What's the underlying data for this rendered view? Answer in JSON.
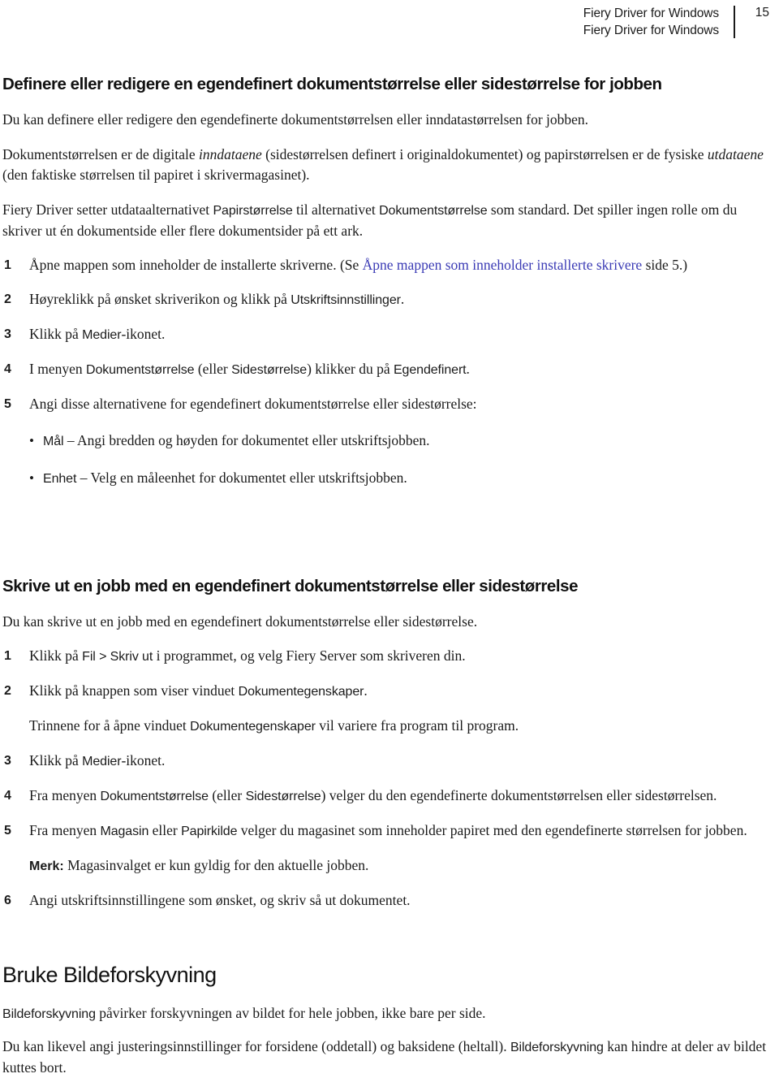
{
  "header": {
    "line1": "Fiery Driver for Windows",
    "line2": "Fiery Driver for Windows",
    "page_number": "15"
  },
  "section1": {
    "title": "Definere eller redigere en egendefinert dokumentstørrelse eller sidestørrelse for jobben",
    "intro": "Du kan definere eller redigere den egendefinerte dokumentstørrelsen eller inndatastørrelsen for jobben.",
    "para2_a": "Dokumentstørrelsen er de digitale ",
    "para2_italic1": "inndataene",
    "para2_b": " (sidestørrelsen definert i originaldokumentet) og papirstørrelsen er de fysiske ",
    "para2_italic2": "utdataene",
    "para2_c": " (den faktiske størrelsen til papiret i skrivermagasinet).",
    "para3_a": "Fiery Driver setter utdataalternativet ",
    "para3_ui1": "Papirstørrelse",
    "para3_b": " til alternativet ",
    "para3_ui2": "Dokumentstørrelse",
    "para3_c": " som standard. Det spiller ingen rolle om du skriver ut én dokumentside eller flere dokumentsider på ett ark.",
    "steps": [
      {
        "num": "1",
        "text_a": "Åpne mappen som inneholder de installerte skriverne. (Se ",
        "link": "Åpne mappen som inneholder installerte skrivere",
        "text_b": " side 5.)"
      },
      {
        "num": "2",
        "text_a": "Høyreklikk på ønsket skriverikon og klikk på ",
        "ui": "Utskriftsinnstillinger",
        "text_b": "."
      },
      {
        "num": "3",
        "text_a": "Klikk på ",
        "ui": "Medier",
        "text_b": "-ikonet."
      },
      {
        "num": "4",
        "text_a": "I menyen ",
        "ui": "Dokumentstørrelse",
        "text_b": " (eller ",
        "ui2": "Sidestørrelse",
        "text_c": ") klikker du på ",
        "ui3": "Egendefinert",
        "text_d": "."
      },
      {
        "num": "5",
        "text_a": "Angi disse alternativene for egendefinert dokumentstørrelse eller sidestørrelse:"
      }
    ],
    "bullets": [
      {
        "ui": "Mål",
        "text": " – Angi bredden og høyden for dokumentet eller utskriftsjobben."
      },
      {
        "ui": "Enhet",
        "text": " – Velg en måleenhet for dokumentet eller utskriftsjobben."
      }
    ]
  },
  "section2": {
    "title": "Skrive ut en jobb med en egendefinert dokumentstørrelse eller sidestørrelse",
    "intro": "Du kan skrive ut en jobb med en egendefinert dokumentstørrelse eller sidestørrelse.",
    "steps": [
      {
        "num": "1",
        "text_a": "Klikk på ",
        "ui": "Fil > Skriv ut",
        "text_b": " i programmet, og velg Fiery Server som skriveren din."
      },
      {
        "num": "2",
        "text_a": "Klikk på knappen som viser vinduet ",
        "ui": "Dokumentegenskaper",
        "text_b": "."
      },
      {
        "num": "3",
        "text_a": "Klikk på ",
        "ui": "Medier",
        "text_b": "-ikonet."
      },
      {
        "num": "4",
        "text_a": "Fra menyen ",
        "ui": "Dokumentstørrelse",
        "text_b": " (eller ",
        "ui2": "Sidestørrelse",
        "text_c": ") velger du den egendefinerte dokumentstørrelsen eller sidestørrelsen."
      },
      {
        "num": "5",
        "text_a": "Fra menyen ",
        "ui": "Magasin",
        "text_b": " eller ",
        "ui2": "Papirkilde",
        "text_c": " velger du magasinet som inneholder papiret med den egendefinerte størrelsen for jobben."
      },
      {
        "num": "6",
        "text_a": "Angi utskriftsinnstillingene som ønsket, og skriv så ut dokumentet."
      }
    ],
    "step2_sub": {
      "text_a": "Trinnene for å åpne vinduet ",
      "ui": "Dokumentegenskaper",
      "text_b": " vil variere fra program til program."
    },
    "note": {
      "label": "Merk:",
      "text": " Magasinvalget er kun gyldig for den aktuelle jobben."
    }
  },
  "section3": {
    "title": "Bruke Bildeforskyvning",
    "para1_ui": "Bildeforskyvning",
    "para1_text": " påvirker forskyvningen av bildet for hele jobben, ikke bare per side.",
    "para2_a": "Du kan likevel angi justeringsinnstillinger for forsidene (oddetall) og baksidene (heltall). ",
    "para2_ui": "Bildeforskyvning",
    "para2_b": " kan hindre at deler av bildet kuttes bort."
  }
}
